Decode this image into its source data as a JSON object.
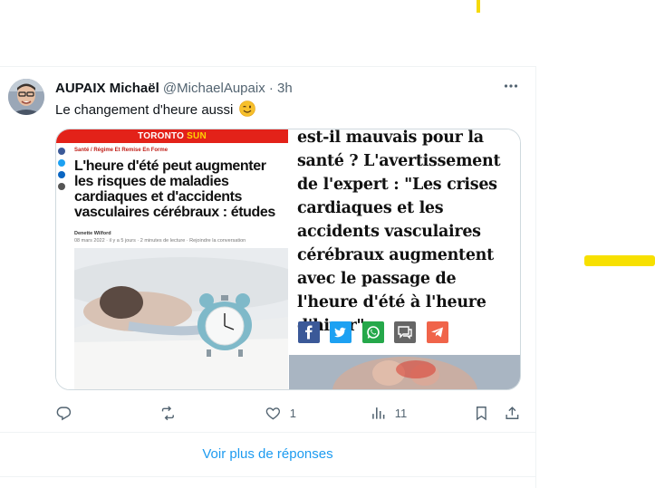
{
  "colors": {
    "accent": "#1d9bf0",
    "text_primary": "#0f1419",
    "text_secondary": "#536471",
    "highlighter": "#f7e000",
    "toronto_sun_red": "#e32219",
    "toronto_sun_yellow": "#ffd200"
  },
  "tweet": {
    "author_name": "AUPAIX Michaël",
    "handle": "@MichaelAupaix",
    "separator": "·",
    "time": "3h",
    "text": "Le changement d'heure aussi",
    "emoji": "winking-face",
    "more_icon": "ellipsis-icon",
    "media": {
      "left_image": {
        "brand_prefix": "TORONTO",
        "brand_suffix": "SUN",
        "breadcrumb": "Santé / Régime Et Remise En Forme",
        "headline": "L'heure d'été peut augmenter les risques de maladies cardiaques et d'accidents vasculaires cérébraux : études",
        "byline_author": "Denette Wilford",
        "byline_meta": "08 mars 2022 · il y a 5 jours · 2 minutes de lecture · Rejoindre la conversation"
      },
      "right_image": {
        "quote": "est-il mauvais pour la santé ? L'avertissement de l'expert : \"Les crises cardiaques et les accidents vasculaires cérébraux augmentent avec le passage de l'heure d'été à l'heure d'hiver\"",
        "share_buttons": [
          {
            "icon": "facebook-icon",
            "color": "#3b5998"
          },
          {
            "icon": "twitter-icon",
            "color": "#1da1f2"
          },
          {
            "icon": "whatsapp-icon",
            "color": "#25a84a"
          },
          {
            "icon": "comment-icon",
            "color": "#666666"
          },
          {
            "icon": "telegram-icon",
            "color": "#f0644a"
          }
        ]
      }
    },
    "actions": {
      "reply_icon": "reply-icon",
      "retweet_icon": "retweet-icon",
      "like_icon": "heart-icon",
      "like_count": "1",
      "views_icon": "views-icon",
      "views_count": "11",
      "bookmark_icon": "bookmark-icon",
      "share_icon": "share-icon"
    }
  },
  "more_replies_label": "Voir plus de réponses"
}
